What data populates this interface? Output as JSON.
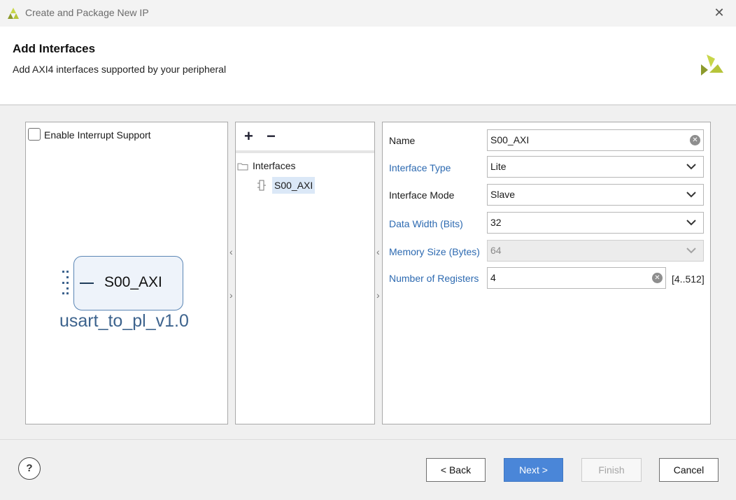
{
  "window": {
    "title": "Create and Package New IP"
  },
  "header": {
    "title": "Add Interfaces",
    "subtitle": "Add AXI4 interfaces supported by your peripheral"
  },
  "left": {
    "interrupt_label": "Enable Interrupt Support",
    "interrupt_checked": false,
    "block_interface": "S00_AXI",
    "block_name": "usart_to_pl_v1.0"
  },
  "mid": {
    "add_symbol": "+",
    "remove_symbol": "−",
    "tree_root": "Interfaces",
    "tree_items": [
      "S00_AXI"
    ]
  },
  "form": {
    "name_label": "Name",
    "name_value": "S00_AXI",
    "type_label": "Interface Type",
    "type_value": "Lite",
    "mode_label": "Interface Mode",
    "mode_value": "Slave",
    "width_label": "Data Width (Bits)",
    "width_value": "32",
    "mem_label": "Memory Size (Bytes)",
    "mem_value": "64",
    "regs_label": "Number of Registers",
    "regs_value": "4",
    "regs_range": "[4..512]"
  },
  "footer": {
    "help": "?",
    "back": "< Back",
    "next": "Next >",
    "finish": "Finish",
    "cancel": "Cancel"
  },
  "colors": {
    "accent": "#4a86d8",
    "link_label": "#2d6ab1",
    "brand": "#b6c43a"
  }
}
